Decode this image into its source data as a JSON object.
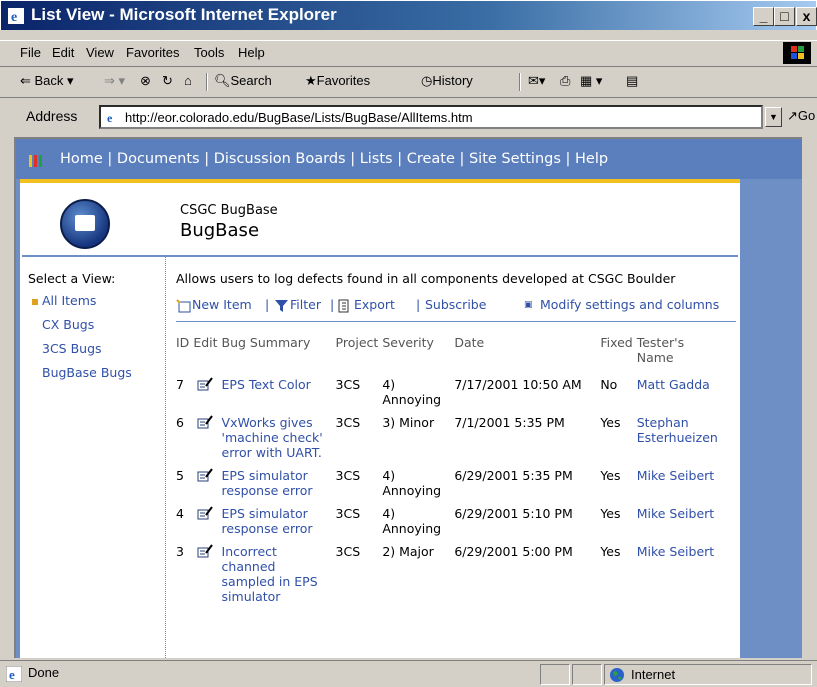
{
  "window": {
    "title": "List View - Microsoft Internet Explorer",
    "min": "_",
    "max": "□",
    "close": "x"
  },
  "menu": [
    "File",
    "Edit",
    "View",
    "Favorites",
    "Tools",
    "Help"
  ],
  "toolbar": {
    "back": "Back",
    "search": "Search",
    "favorites": "Favorites",
    "history": "History"
  },
  "address": {
    "label": "Address",
    "url": "http://eor.colorado.edu/BugBase/Lists/BugBase/AllItems.htm",
    "go": "Go"
  },
  "site": {
    "nav": "Home | Documents | Discussion Boards | Lists | Create | Site Settings | Help",
    "subtitle": "CSGC BugBase",
    "title": "BugBase"
  },
  "views": {
    "label": "Select a View:",
    "items": [
      "All Items",
      "CX Bugs",
      "3CS Bugs",
      "BugBase Bugs"
    ]
  },
  "list": {
    "description": "Allows users to log defects found in all components developed at CSGC Boulder",
    "actions": {
      "new_item": "New Item",
      "filter": "Filter",
      "export": "Export",
      "subscribe": "Subscribe",
      "modify": "Modify settings and columns"
    },
    "columns": [
      "ID",
      "Edit",
      "Bug Summary",
      "Project",
      "Severity",
      "Date",
      "Fixed",
      "Tester's Name"
    ],
    "rows": [
      {
        "id": "7",
        "summary": "EPS Text Color",
        "project": "3CS",
        "severity": "4) Annoying",
        "date": "7/17/2001 10:50 AM",
        "fixed": "No",
        "tester": "Matt Gadda"
      },
      {
        "id": "6",
        "summary": "VxWorks gives 'machine check' error with UART.",
        "project": "3CS",
        "severity": "3) Minor",
        "date": "7/1/2001 5:35 PM",
        "fixed": "Yes",
        "tester": "Stephan Esterhueizen"
      },
      {
        "id": "5",
        "summary": "EPS simulator response error",
        "project": "3CS",
        "severity": "4) Annoying",
        "date": "6/29/2001 5:35 PM",
        "fixed": "Yes",
        "tester": "Mike Seibert"
      },
      {
        "id": "4",
        "summary": "EPS simulator response error",
        "project": "3CS",
        "severity": "4) Annoying",
        "date": "6/29/2001 5:10 PM",
        "fixed": "Yes",
        "tester": "Mike Seibert"
      },
      {
        "id": "3",
        "summary": "Incorrect channed sampled in EPS simulator",
        "project": "3CS",
        "severity": "2) Major",
        "date": "6/29/2001 5:00 PM",
        "fixed": "Yes",
        "tester": "Mike Seibert"
      }
    ]
  },
  "status": {
    "text": "Done",
    "zone": "Internet"
  }
}
